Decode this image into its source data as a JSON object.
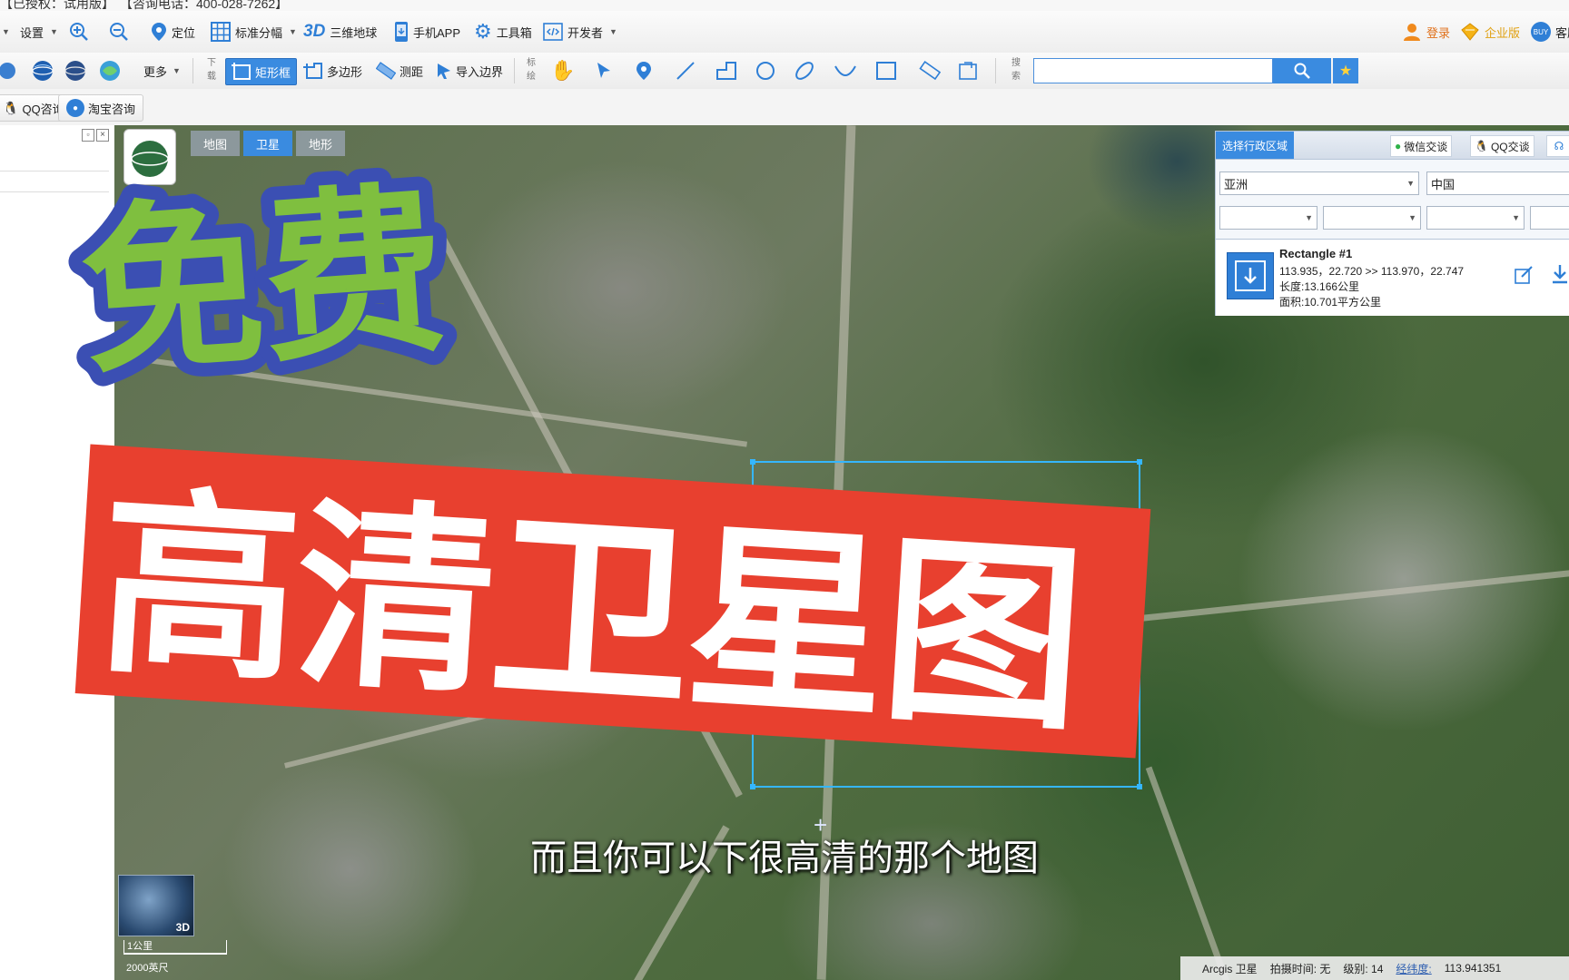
{
  "topstrip": {
    "license": "【已授权：试用版】",
    "phone": "【咨询电话：400-028-7262】"
  },
  "menu": {
    "settings": "设置",
    "locate": "定位",
    "standard_sheet": "标准分幅",
    "globe3d_badge": "3D",
    "globe3d": "三维地球",
    "mobile_app": "手机APP",
    "toolbox": "工具箱",
    "developer": "开发者",
    "login": "登录",
    "enterprise": "企业版",
    "service": "客服"
  },
  "toolbar": {
    "more": "更多",
    "download_label": "下载",
    "rect": "矩形框",
    "polygon": "多边形",
    "measure": "测距",
    "import_boundary": "导入边界",
    "mark_label": "标绘",
    "search_label": "搜索",
    "search_value": ""
  },
  "row3": {
    "qq": "QQ咨询",
    "taobao": "淘宝咨询"
  },
  "map": {
    "tabs": [
      {
        "label": "地图"
      },
      {
        "label": "卫星"
      },
      {
        "label": "地形"
      }
    ],
    "active_tab": "卫星",
    "scale_km": "1公里",
    "scale_ft": "2000英尺",
    "badge_3d": "3D"
  },
  "region_panel": {
    "title": "选择行政区域",
    "wechat": "微信交谈",
    "qq": "QQ交谈",
    "continent": "亚洲",
    "country": "中国"
  },
  "shape": {
    "name": "Rectangle #1",
    "coords": "113.935，22.720 >> 113.970，22.747",
    "length": "长度:13.166公里",
    "area": "面积:10.701平方公里"
  },
  "overlay": {
    "free": "免费",
    "hd_satellite": "高清卫星图",
    "subtitle": "而且你可以下很高清的那个地图"
  },
  "status": {
    "source": "Arcgis 卫星",
    "capture_time": "拍摄时间: 无",
    "level": "级别:  14",
    "lnglat_label": "经纬度:",
    "lnglat_value": "113.941351"
  },
  "colors": {
    "accent": "#3a8be0",
    "free_fill": "#7fbf3f",
    "free_stroke": "#3b4fb3",
    "banner_red": "#e8402f",
    "selection": "#35b6ff"
  }
}
